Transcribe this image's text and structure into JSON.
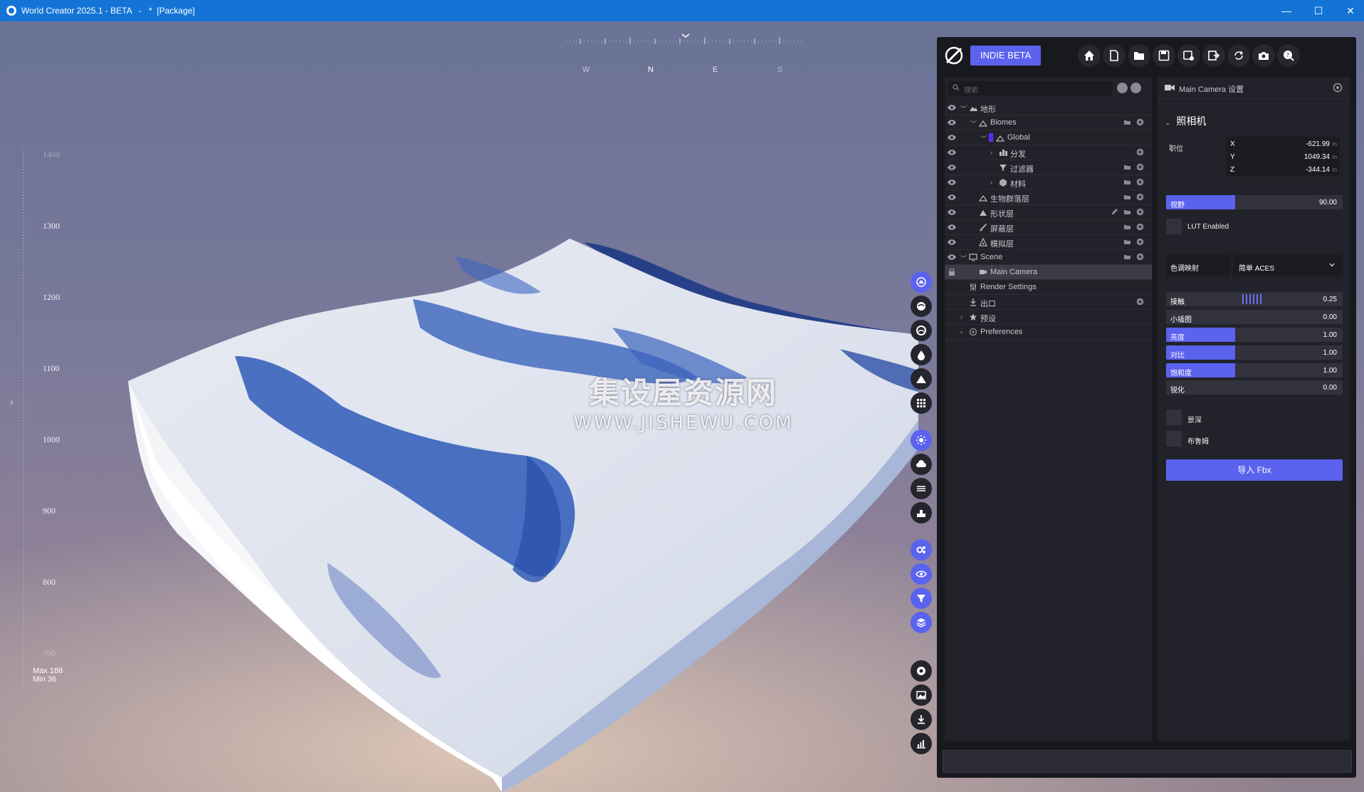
{
  "window": {
    "title": "World Creator 2025.1 - BETA   -   *  [Package]",
    "min_glyph": "—",
    "max_glyph": "☐",
    "close_glyph": "✕"
  },
  "compass": {
    "labels": [
      "W",
      "N",
      "E",
      "S"
    ]
  },
  "height_ruler": {
    "ticks": [
      "1400",
      "1300",
      "1200",
      "1100",
      "1000",
      "900",
      "800",
      "700"
    ],
    "max_text": "Max 188",
    "min_text": "Min 36"
  },
  "watermark": {
    "line1": "集设屋资源网",
    "line2": "WWW.JISHEWU.COM"
  },
  "left_toggle": "›",
  "tool_icons": [
    "terrain-brush-icon",
    "globe-icon",
    "water-ring-icon",
    "drop-icon",
    "mountain-icon",
    "grid-icon",
    "sun-icon",
    "cloud-icon",
    "layers-lines-icon",
    "stamp-icon",
    "gears-icon",
    "eye-icon",
    "filter-icon",
    "stack-icon",
    "record-icon",
    "image-icon",
    "download-icon",
    "chart-icon"
  ],
  "toolbar": {
    "edition_label": "INDIE BETA",
    "buttons": [
      "home-icon",
      "new-file-icon",
      "open-folder-icon",
      "save-icon",
      "save-as-icon",
      "export-icon",
      "sync-icon",
      "camera-icon",
      "help-icon"
    ]
  },
  "scene_tree": {
    "search_placeholder": "搜索",
    "rows": [
      {
        "label": "地形",
        "indent": 0,
        "chev": "down",
        "eye": true,
        "icon": "terrain-icon",
        "actions": []
      },
      {
        "label": "Biomes",
        "indent": 1,
        "chev": "down",
        "eye": true,
        "icon": "biome-icon",
        "actions": [
          "folder",
          "add"
        ]
      },
      {
        "label": "Global",
        "indent": 2,
        "chev": "down",
        "eye": true,
        "icon": "biome-icon",
        "color": "#5b2cf0",
        "actions": []
      },
      {
        "label": "分发",
        "indent": 3,
        "chev": "right",
        "eye": true,
        "icon": "distribution-icon",
        "actions": [
          "add"
        ]
      },
      {
        "label": "过滤器",
        "indent": 3,
        "chev": "",
        "eye": true,
        "icon": "filter-icon",
        "actions": [
          "folder",
          "add"
        ]
      },
      {
        "label": "材料",
        "indent": 3,
        "chev": "right",
        "eye": true,
        "icon": "material-icon",
        "actions": [
          "folder",
          "add"
        ]
      },
      {
        "label": "生物群落层",
        "indent": 1,
        "chev": "",
        "eye": true,
        "icon": "biome-icon",
        "actions": [
          "folder",
          "add"
        ]
      },
      {
        "label": "形状层",
        "indent": 1,
        "chev": "",
        "eye": true,
        "icon": "shape-icon",
        "actions": [
          "edit",
          "folder",
          "add"
        ]
      },
      {
        "label": "屏蔽层",
        "indent": 1,
        "chev": "",
        "eye": true,
        "icon": "brush-icon",
        "actions": [
          "folder",
          "add"
        ]
      },
      {
        "label": "模拟层",
        "indent": 1,
        "chev": "",
        "eye": true,
        "icon": "simulation-icon",
        "actions": [
          "folder",
          "add"
        ]
      },
      {
        "label": "Scene",
        "indent": 0,
        "chev": "down",
        "eye": true,
        "icon": "monitor-icon",
        "actions": [
          "folder",
          "add"
        ]
      },
      {
        "label": "Main Camera",
        "indent": 1,
        "chev": "",
        "eye": false,
        "lock": true,
        "icon": "camera-icon",
        "selected": true,
        "actions": []
      },
      {
        "label": "Render Settings",
        "indent": 0,
        "chev": "",
        "eye": false,
        "icon": "sliders-icon",
        "actions": []
      },
      {
        "label": "出口",
        "indent": 0,
        "chev": "",
        "eye": false,
        "icon": "download-icon",
        "actions": [
          "add"
        ]
      },
      {
        "label": "预设",
        "indent": 0,
        "chev": "right",
        "eye": false,
        "icon": "star-icon",
        "actions": []
      },
      {
        "label": "Preferences",
        "indent": 0,
        "chev": "right",
        "eye": false,
        "icon": "gear-icon",
        "actions": []
      }
    ]
  },
  "inspector": {
    "header": "Main Camera 设置",
    "section_title": "照相机",
    "position_label": "职位",
    "position": [
      {
        "axis": "X",
        "value": "-621.99",
        "unit": "m"
      },
      {
        "axis": "Y",
        "value": "1049.34",
        "unit": "m"
      },
      {
        "axis": "Z",
        "value": "-344.14",
        "unit": "m"
      }
    ],
    "fov": {
      "label": "视野",
      "value": "90.00",
      "fraction": 0.39
    },
    "lut_label": "LUT Enabled",
    "tonemap_label": "色调映射",
    "tonemap_value": "简单 ACES",
    "adjust_sliders": [
      {
        "label": "接触",
        "value": "0.25",
        "fraction": 0,
        "stripes": true
      },
      {
        "label": "小插图",
        "value": "0.00",
        "fraction": 0
      },
      {
        "label": "亮度",
        "value": "1.00",
        "fraction": 0.39
      },
      {
        "label": "对比",
        "value": "1.00",
        "fraction": 0.39
      },
      {
        "label": "饱和度",
        "value": "1.00",
        "fraction": 0.39
      },
      {
        "label": "锐化",
        "value": "0.00",
        "fraction": 0
      }
    ],
    "dof_label": "景深",
    "bloom_label": "布鲁姆",
    "import_label": "导入 Fbx"
  },
  "colors": {
    "accent": "#5a62ee",
    "panel": "#18191e",
    "pane": "#22232a",
    "titlebar": "#1474d6"
  }
}
